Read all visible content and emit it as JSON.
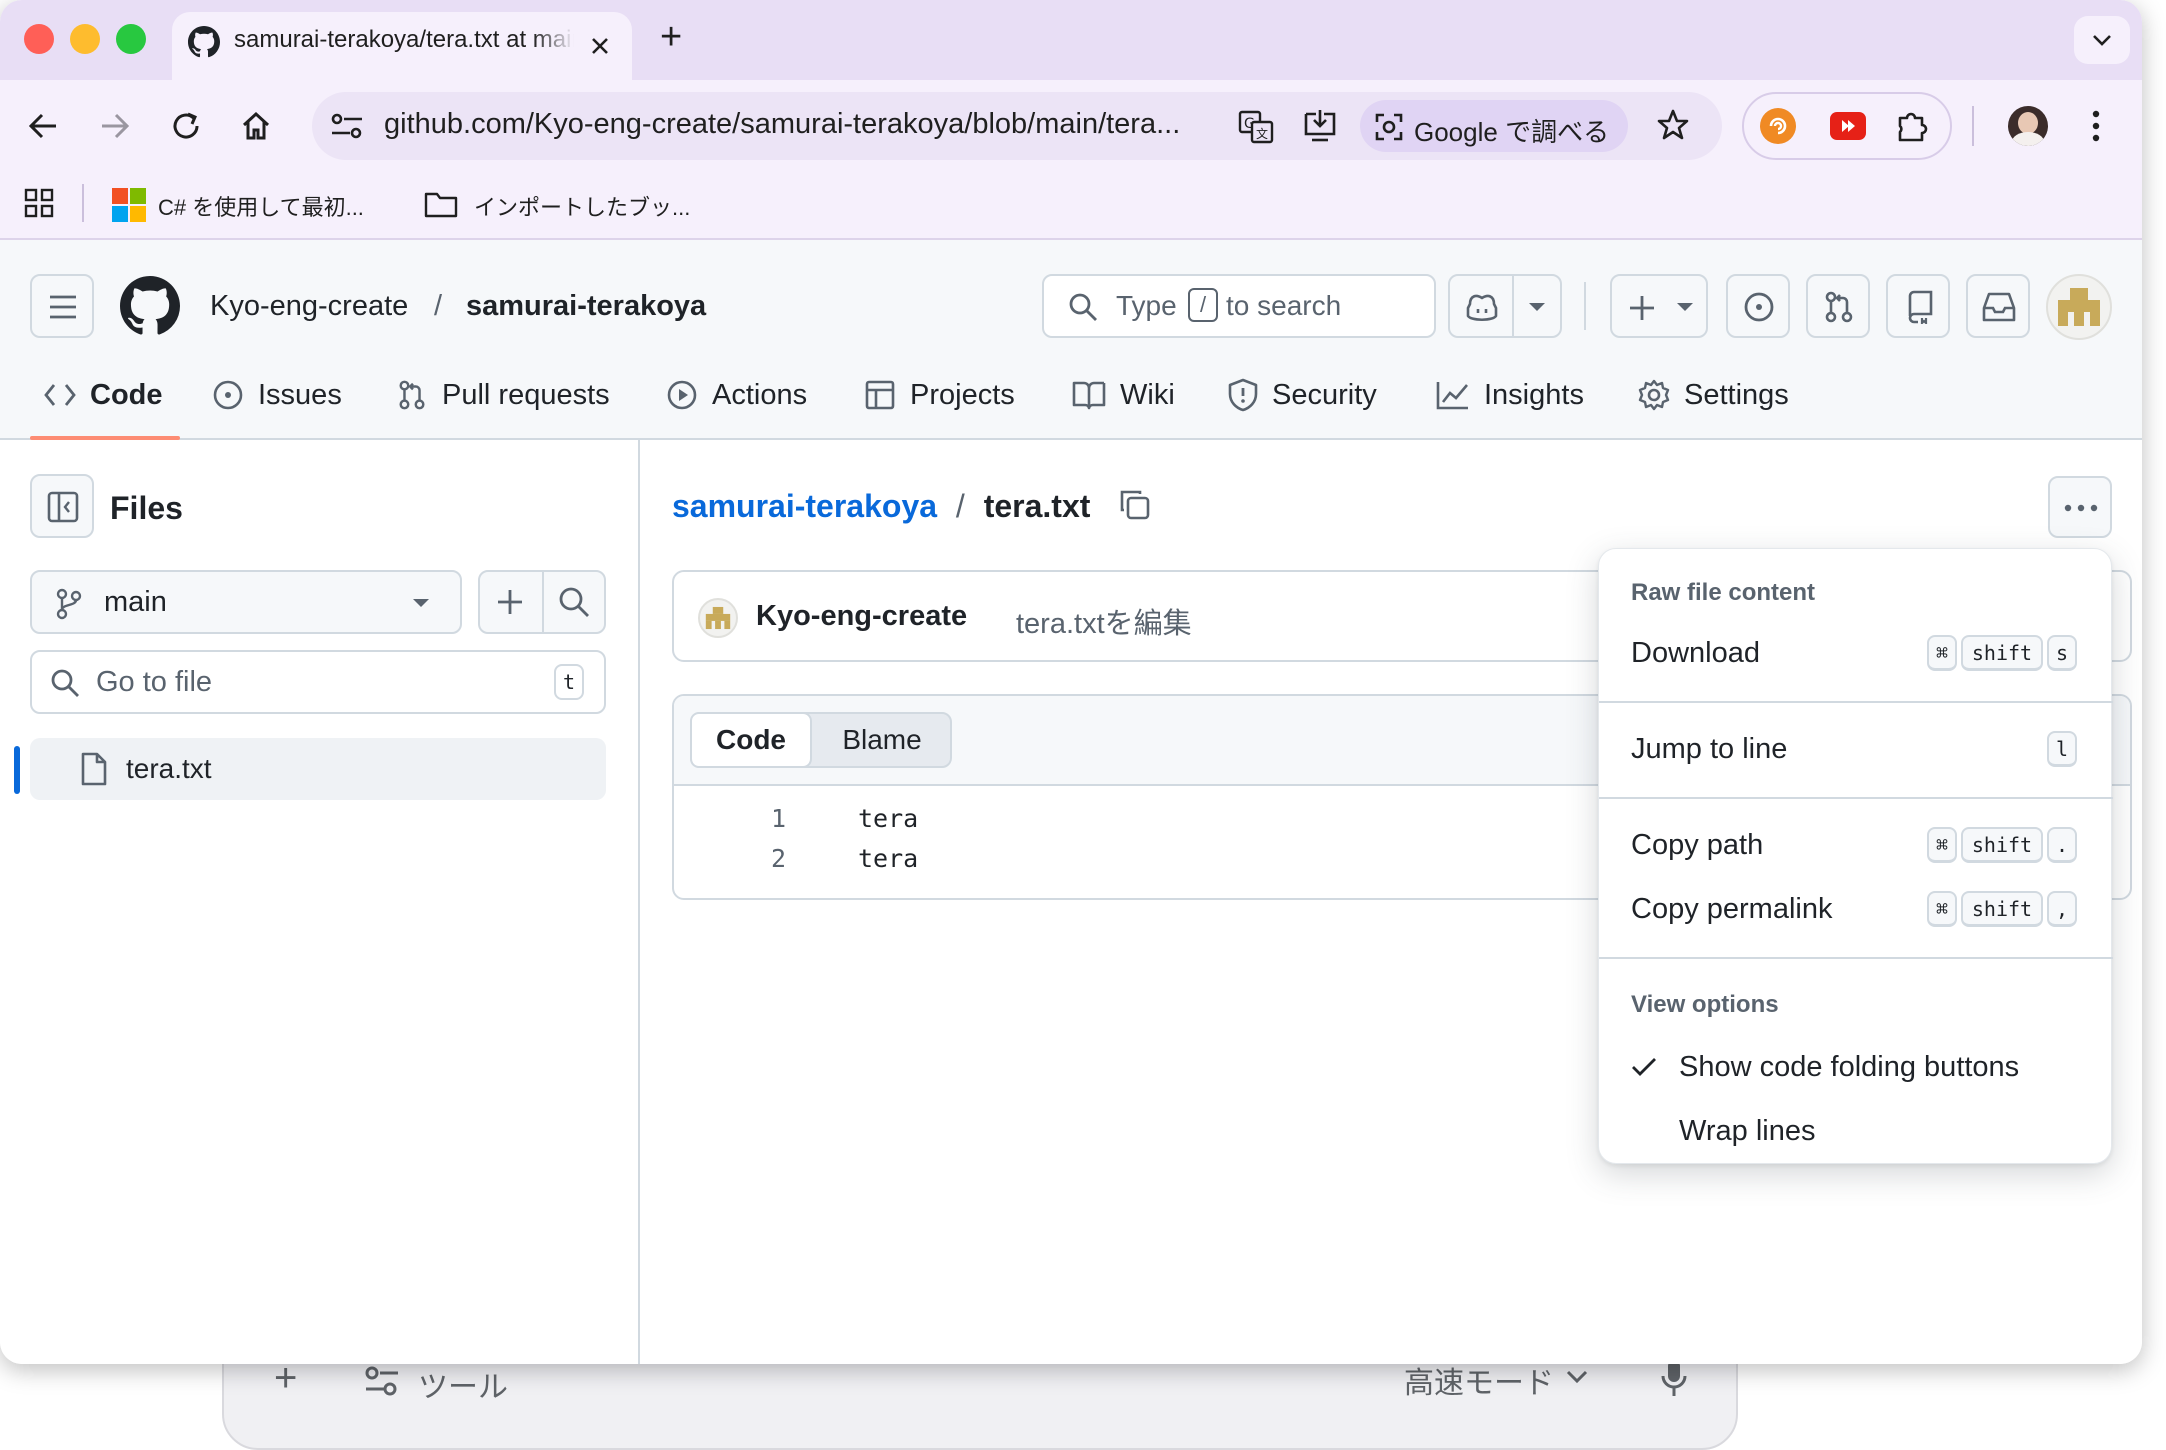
{
  "browser": {
    "tab_title": "samurai-terakoya/tera.txt at main",
    "new_tab_label": "+",
    "url": "github.com/Kyo-eng-create/samurai-terakoya/blob/main/tera...",
    "lens_label": "Google で調べる",
    "bookmarks": [
      {
        "label": "C# を使用して最初..."
      },
      {
        "label": "インポートしたブッ..."
      }
    ]
  },
  "background_window": {
    "tools_label": "ツール",
    "mode_label": "高速モード"
  },
  "header": {
    "owner": "Kyo-eng-create",
    "separator": "/",
    "repo": "samurai-terakoya",
    "search_prefix": "Type",
    "search_key": "/",
    "search_suffix": "to search"
  },
  "nav": {
    "tabs": [
      {
        "label": "Code",
        "icon": "code-icon"
      },
      {
        "label": "Issues",
        "icon": "issue-icon"
      },
      {
        "label": "Pull requests",
        "icon": "pull-request-icon"
      },
      {
        "label": "Actions",
        "icon": "play-icon"
      },
      {
        "label": "Projects",
        "icon": "table-icon"
      },
      {
        "label": "Wiki",
        "icon": "book-icon"
      },
      {
        "label": "Security",
        "icon": "shield-icon"
      },
      {
        "label": "Insights",
        "icon": "graph-icon"
      },
      {
        "label": "Settings",
        "icon": "gear-icon"
      }
    ],
    "active": "Code"
  },
  "sidebar": {
    "title": "Files",
    "branch": "main",
    "go_to_file_placeholder": "Go to file",
    "go_to_file_key": "t",
    "tree": [
      {
        "name": "tera.txt"
      }
    ]
  },
  "main": {
    "breadcrumb_repo": "samurai-terakoya",
    "breadcrumb_sep": "/",
    "breadcrumb_file": "tera.txt",
    "commit_author": "Kyo-eng-create",
    "commit_message": "tera.txtを編集",
    "view_tabs": [
      "Code",
      "Blame"
    ],
    "code_lines": [
      {
        "no": "1",
        "text": "tera"
      },
      {
        "no": "2",
        "text": "tera"
      }
    ]
  },
  "menu": {
    "raw_heading": "Raw file content",
    "download": {
      "label": "Download",
      "keys": [
        "⌘",
        "shift",
        "s"
      ]
    },
    "jump_to_line": {
      "label": "Jump to line",
      "keys": [
        "l"
      ]
    },
    "copy_path": {
      "label": "Copy path",
      "keys": [
        "⌘",
        "shift",
        "."
      ]
    },
    "copy_permalink": {
      "label": "Copy permalink",
      "keys": [
        "⌘",
        "shift",
        ","
      ]
    },
    "view_heading": "View options",
    "show_folding": {
      "label": "Show code folding buttons",
      "checked": true
    },
    "wrap_lines": {
      "label": "Wrap lines",
      "checked": false
    }
  },
  "colors": {
    "accent_link": "#0969da",
    "nav_underline": "#fd8c73",
    "tabstrip": "#e8def5"
  }
}
